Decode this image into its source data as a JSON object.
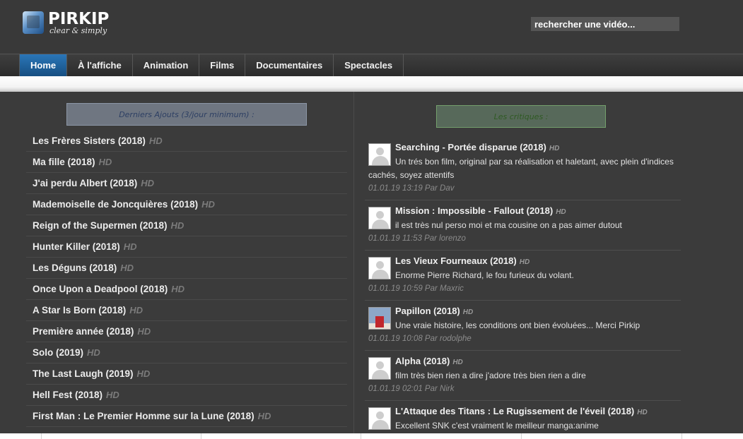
{
  "logo": {
    "title": "PIRKIP",
    "subtitle": "clear & simply"
  },
  "search": {
    "placeholder": "rechercher une vidéo..."
  },
  "nav": [
    {
      "label": "Home",
      "active": true
    },
    {
      "label": "À l'affiche",
      "active": false
    },
    {
      "label": "Animation",
      "active": false
    },
    {
      "label": "Films",
      "active": false
    },
    {
      "label": "Documentaires",
      "active": false
    },
    {
      "label": "Spectacles",
      "active": false
    }
  ],
  "latest": {
    "title": "Derniers Ajouts (3/jour minimum) :",
    "items": [
      {
        "title": "Les Frères Sisters (2018)",
        "badge": "HD"
      },
      {
        "title": "Ma fille (2018)",
        "badge": "HD"
      },
      {
        "title": "J'ai perdu Albert (2018)",
        "badge": "HD"
      },
      {
        "title": "Mademoiselle de Joncquières (2018)",
        "badge": "HD"
      },
      {
        "title": "Reign of the Supermen (2018)",
        "badge": "HD"
      },
      {
        "title": "Hunter Killer (2018)",
        "badge": "HD"
      },
      {
        "title": "Les Déguns (2018)",
        "badge": "HD"
      },
      {
        "title": "Once Upon a Deadpool (2018)",
        "badge": "HD"
      },
      {
        "title": "A Star Is Born (2018)",
        "badge": "HD"
      },
      {
        "title": "Première année (2018)",
        "badge": "HD"
      },
      {
        "title": "Solo (2019)",
        "badge": "HD"
      },
      {
        "title": "The Last Laugh (2019)",
        "badge": "HD"
      },
      {
        "title": "Hell Fest (2018)",
        "badge": "HD"
      },
      {
        "title": "First Man : Le Premier Homme sur la Lune (2018)",
        "badge": "HD"
      }
    ]
  },
  "reviews": {
    "title": "Les critiques :",
    "items": [
      {
        "title": "Searching - Portée disparue (2018)",
        "badge": "HD",
        "text": "Un trés bon film, original par sa réalisation et haletant, avec plein d'indices",
        "text2": "cachés, soyez attentifs",
        "meta": "01.01.19 13:19 Par Dav",
        "avatar": "default"
      },
      {
        "title": "Mission : Impossible - Fallout (2018)",
        "badge": "HD",
        "text": "il est très nul perso moi et ma cousine on a pas aimer dutout",
        "text2": "",
        "meta": "01.01.19 11:53 Par lorenzo",
        "avatar": "default"
      },
      {
        "title": "Les Vieux Fourneaux (2018)",
        "badge": "HD",
        "text": "Enorme Pierre Richard, le fou furieux du volant.",
        "text2": "",
        "meta": "01.01.19 10:59 Par Maxric",
        "avatar": "default"
      },
      {
        "title": "Papillon (2018)",
        "badge": "HD",
        "text": "Une vraie histoire, les conditions ont bien évoluées... Merci Pirkip",
        "text2": "",
        "meta": "01.01.19 10:08 Par rodolphe",
        "avatar": "photo"
      },
      {
        "title": "Alpha (2018)",
        "badge": "HD",
        "text": "film très bien rien a dire j'adore très bien rien a dire",
        "text2": "",
        "meta": "01.01.19 02:01 Par Nirk",
        "avatar": "default"
      },
      {
        "title": "L'Attaque des Titans : Le Rugissement de l'éveil (2018)",
        "badge": "HD",
        "text": "Excellent SNK c'est vraiment le meilleur manga:anime",
        "text2": "",
        "meta": "",
        "avatar": "default"
      }
    ]
  }
}
